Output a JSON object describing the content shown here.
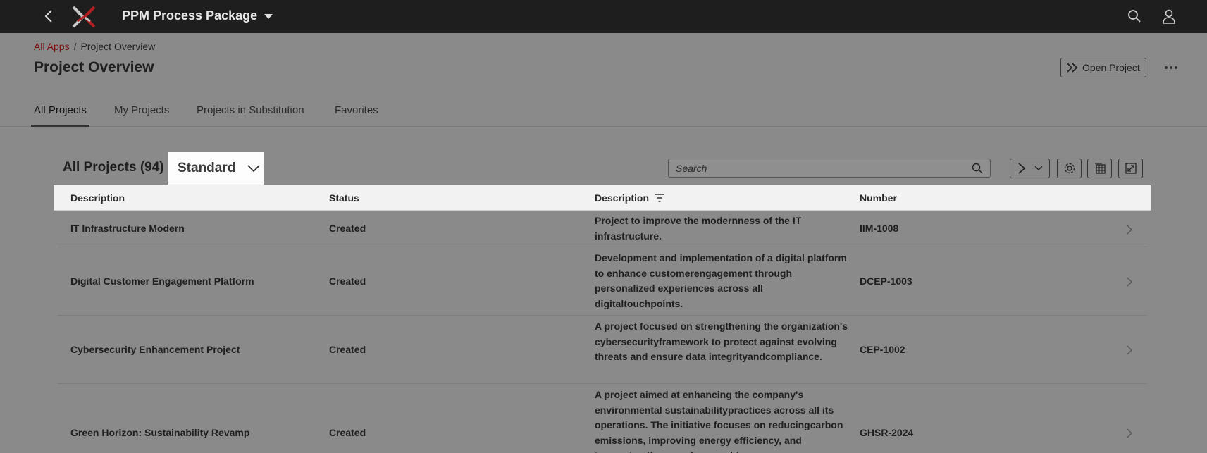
{
  "shell": {
    "title": "PPM Process Package",
    "icons": [
      "chevron-left-icon",
      "brand-logo",
      "caret-down-icon",
      "search-icon",
      "user-icon"
    ]
  },
  "breadcrumb": {
    "link": "All Apps",
    "separator": "/",
    "current": "Project Overview"
  },
  "header": {
    "title": "Project Overview",
    "open_project_label": "Open Project"
  },
  "tabs": [
    {
      "label": "All Projects",
      "active": true
    },
    {
      "label": "My Projects",
      "active": false
    },
    {
      "label": "Projects in Substitution",
      "active": false
    },
    {
      "label": "Favorites",
      "active": false
    }
  ],
  "table": {
    "title": "All Projects (94)",
    "variant": "Standard",
    "search_placeholder": "Search",
    "columns": [
      "Description",
      "Status",
      "Description",
      "Number"
    ],
    "rows": [
      {
        "description": "IT Infrastructure Modern",
        "status": "Created",
        "long_description": "Project to improve the modernness of the IT infrastructure.",
        "number": "IIM-1008"
      },
      {
        "description": "Digital Customer Engagement Platform",
        "status": "Created",
        "long_description": "Development and implementation of a digital platform to enhance customerengagement through personalized experiences across all digitaltouchpoints.",
        "number": "DCEP-1003"
      },
      {
        "description": "Cybersecurity Enhancement Project",
        "status": "Created",
        "long_description": "A project focused on strengthening the organization's cybersecurityframework to protect against evolving threats and ensure data integrityandcompliance.",
        "number": "CEP-1002"
      },
      {
        "description": "Green Horizon: Sustainability Revamp",
        "status": "Created",
        "long_description": "A project aimed at enhancing the company's environmental sustainabilitypractices across all its operations. The initiative focuses on reducingcarbon emissions, improving energy efficiency, and increasing the use of renewable",
        "number": "GHSR-2024"
      }
    ]
  },
  "colors": {
    "shell_bg": "#1e1e1e",
    "page_bg": "#8a8a8a",
    "link": "#7a0b0b",
    "header_row": "#f2f2f2"
  }
}
